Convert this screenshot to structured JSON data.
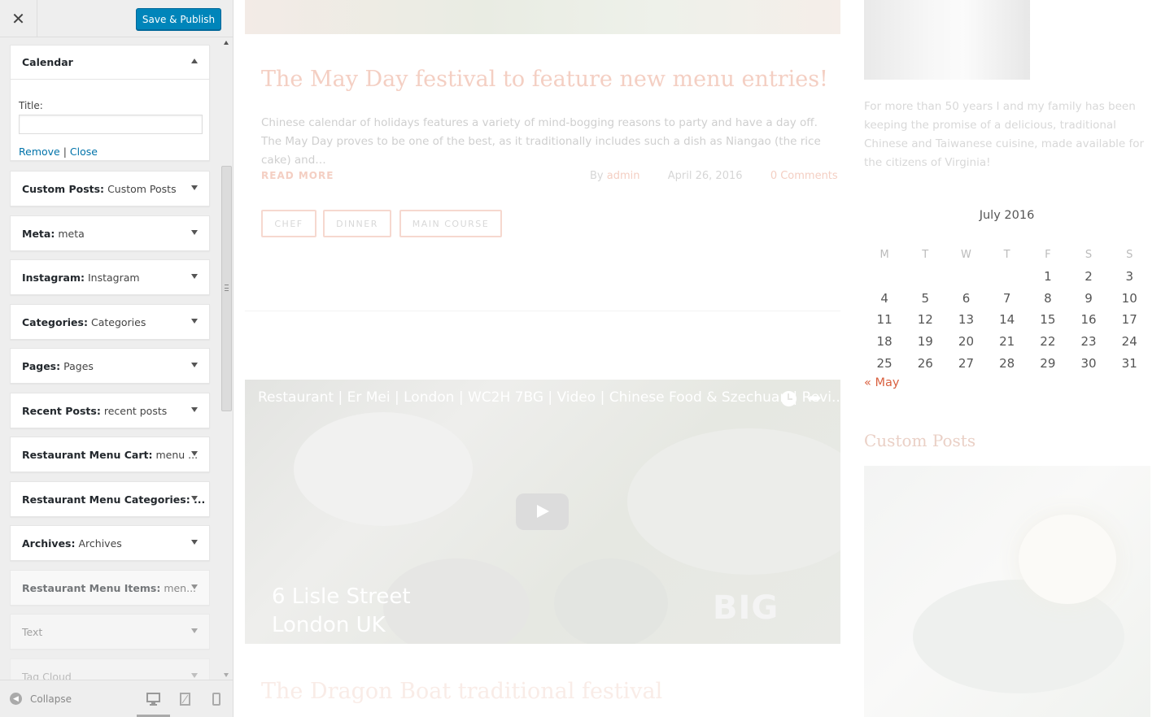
{
  "customizer": {
    "close_glyph": "✕",
    "publish_label": "Save & Publish",
    "open_widget": {
      "title": "Calendar",
      "title_field_label": "Title:",
      "title_field_value": "",
      "remove_link": "Remove",
      "separator": "|",
      "close_link": "Close"
    },
    "widgets": [
      {
        "title": "Custom Posts:",
        "subtitle": "Custom Posts"
      },
      {
        "title": "Meta:",
        "subtitle": "meta"
      },
      {
        "title": "Instagram:",
        "subtitle": "Instagram"
      },
      {
        "title": "Categories:",
        "subtitle": "Categories"
      },
      {
        "title": "Pages:",
        "subtitle": "Pages"
      },
      {
        "title": "Recent Posts:",
        "subtitle": "recent posts"
      },
      {
        "title": "Restaurant Menu Cart:",
        "subtitle": "menu ..."
      },
      {
        "title": "Restaurant Menu Categories: ...",
        "subtitle": ""
      },
      {
        "title": "Archives:",
        "subtitle": "Archives"
      },
      {
        "title": "Restaurant Menu Items:",
        "subtitle": "men..."
      },
      {
        "title": "Text",
        "subtitle": ""
      },
      {
        "title": "Tag Cloud",
        "subtitle": ""
      }
    ],
    "collapse_label": "Collapse",
    "accent_color": "#0085ba"
  },
  "preview": {
    "post": {
      "title": "The May Day festival to feature new menu entries!",
      "excerpt": "Chinese calendar of holidays features a variety of mind-bogging reasons to party and have a day off. The May Day proves to be one of the best, as it traditionally includes such a dish as Niangao (the rice cake) and…",
      "read_more": "READ MORE",
      "by": "By",
      "author": "admin",
      "date": "April 26, 2016",
      "comments": "0 Comments",
      "tags": [
        "CHEF",
        "DINNER",
        "MAIN COURSE"
      ]
    },
    "video": {
      "title": "Restaurant | Er Mei | London | WC2H 7BG | Video | Chinese Food & Szechuan | Revi...",
      "address_line1": "6 Lisle Street",
      "address_line2": "London UK",
      "logo_text": "BIG",
      "share_glyph": "➦"
    },
    "next_post_title": "The Dragon Boat traditional festival",
    "about_text": "For more than 50 years I and my family has been keeping the promise of a delicious, traditional Chinese and Taiwanese cuisine, made available for the citizens of Virginia!",
    "calendar": {
      "caption": "July 2016",
      "weekdays": [
        "M",
        "T",
        "W",
        "T",
        "F",
        "S",
        "S"
      ],
      "weeks": [
        [
          "",
          "",
          "",
          "",
          "1",
          "2",
          "3"
        ],
        [
          "4",
          "5",
          "6",
          "7",
          "8",
          "9",
          "10"
        ],
        [
          "11",
          "12",
          "13",
          "14",
          "15",
          "16",
          "17"
        ],
        [
          "18",
          "19",
          "20",
          "21",
          "22",
          "23",
          "24"
        ],
        [
          "25",
          "26",
          "27",
          "28",
          "29",
          "30",
          "31"
        ]
      ],
      "prev_link": "« May"
    },
    "custom_posts_title": "Custom Posts"
  }
}
